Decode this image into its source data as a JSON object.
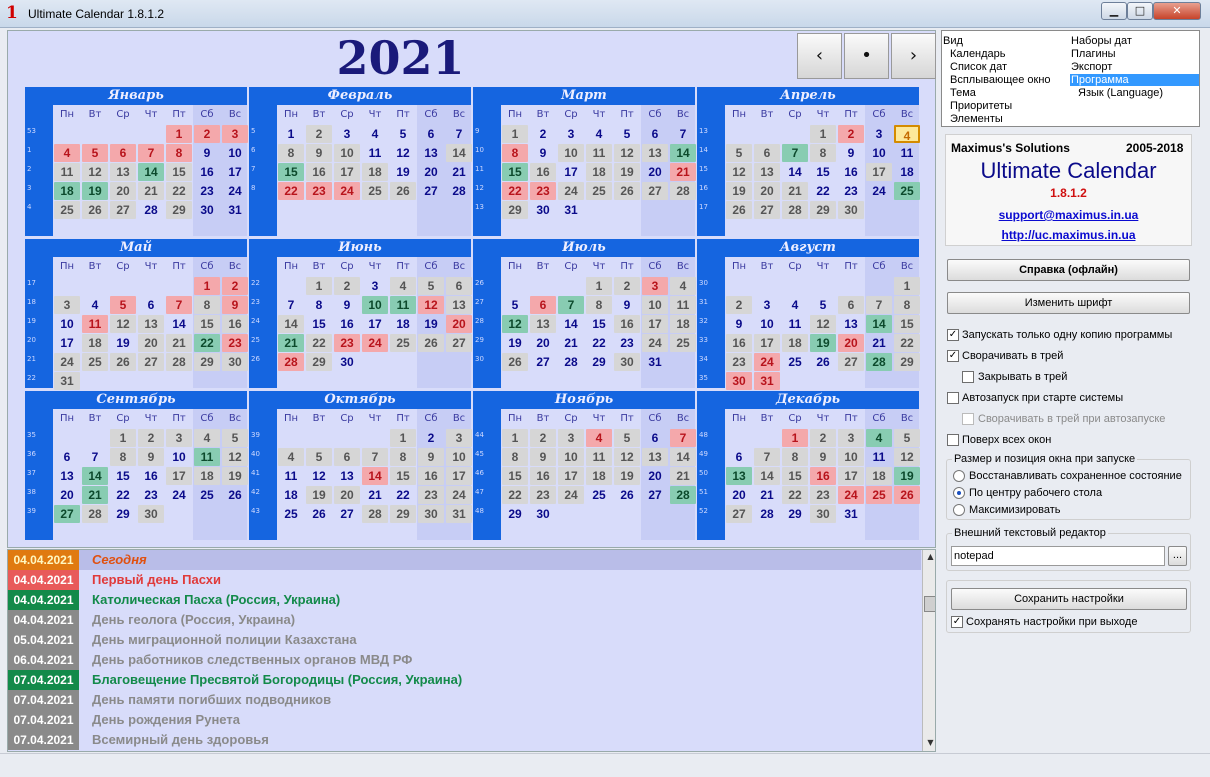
{
  "window": {
    "title": "Ultimate Calendar 1.8.1.2",
    "icon": "1",
    "min": "▁",
    "max": "□",
    "close": "✕"
  },
  "year": "2021",
  "nav": {
    "prev": "‹",
    "today": "•",
    "next": "›"
  },
  "daynames": [
    "Пн",
    "Вт",
    "Ср",
    "Чт",
    "Пт",
    "Сб",
    "Вс"
  ],
  "months": [
    {
      "name": "Январь",
      "weeks": [
        "53",
        "1",
        "2",
        "3",
        "4"
      ],
      "start": 4,
      "days": 31,
      "hol": [
        1,
        2,
        3,
        4,
        5,
        6,
        7,
        8
      ],
      "ev": [
        14,
        18,
        19
      ],
      "wk": [
        4,
        5,
        6,
        7,
        8,
        11,
        12,
        13,
        14,
        15,
        18,
        19,
        20,
        21,
        22,
        25,
        26,
        27,
        29
      ]
    },
    {
      "name": "Февраль",
      "weeks": [
        "5",
        "6",
        "7",
        "8"
      ],
      "start": 0,
      "days": 28,
      "hol": [
        22,
        23,
        24
      ],
      "ev": [
        15
      ],
      "wk": [
        2,
        8,
        9,
        10,
        14,
        16,
        17,
        18,
        25,
        26
      ]
    },
    {
      "name": "Март",
      "weeks": [
        "9",
        "10",
        "11",
        "12",
        "13"
      ],
      "start": 0,
      "days": 31,
      "hol": [
        8,
        21,
        22,
        23
      ],
      "ev": [
        14,
        15
      ],
      "wk": [
        1,
        10,
        11,
        12,
        13,
        16,
        18,
        19,
        24,
        25,
        26,
        27,
        28,
        29
      ]
    },
    {
      "name": "Апрель",
      "weeks": [
        "13",
        "14",
        "15",
        "16",
        "17"
      ],
      "start": 3,
      "days": 30,
      "hol": [
        2
      ],
      "ev": [
        7,
        25
      ],
      "wk": [
        1,
        5,
        6,
        8,
        12,
        13,
        17,
        19,
        20,
        21,
        26,
        27,
        28,
        29,
        30
      ],
      "today": 4
    },
    {
      "name": "Май",
      "weeks": [
        "17",
        "18",
        "19",
        "20",
        "21",
        "22"
      ],
      "start": 5,
      "days": 31,
      "hol": [
        1,
        2,
        5,
        7,
        9,
        11,
        23
      ],
      "ev": [
        22
      ],
      "wk": [
        3,
        8,
        12,
        13,
        15,
        16,
        18,
        20,
        21,
        24,
        25,
        26,
        27,
        28,
        29,
        30,
        31
      ]
    },
    {
      "name": "Июнь",
      "weeks": [
        "22",
        "23",
        "24",
        "25",
        "26"
      ],
      "start": 1,
      "days": 30,
      "hol": [
        12,
        20,
        23,
        24,
        28
      ],
      "ev": [
        10,
        11,
        21
      ],
      "wk": [
        1,
        2,
        4,
        5,
        6,
        13,
        14,
        22,
        25,
        26,
        27,
        29
      ]
    },
    {
      "name": "Июль",
      "weeks": [
        "26",
        "27",
        "28",
        "29",
        "30"
      ],
      "start": 3,
      "days": 31,
      "hol": [
        3,
        6
      ],
      "ev": [
        7,
        12
      ],
      "wk": [
        1,
        2,
        4,
        8,
        10,
        11,
        13,
        16,
        17,
        18,
        24,
        25,
        26,
        30
      ]
    },
    {
      "name": "Август",
      "weeks": [
        "30",
        "31",
        "32",
        "33",
        "34",
        "35"
      ],
      "start": 6,
      "days": 31,
      "hol": [
        20,
        24,
        30,
        31
      ],
      "ev": [
        14,
        19,
        28
      ],
      "wk": [
        1,
        2,
        6,
        7,
        8,
        12,
        15,
        16,
        17,
        18,
        22,
        23,
        27,
        29
      ]
    },
    {
      "name": "Сентябрь",
      "weeks": [
        "35",
        "36",
        "37",
        "38",
        "39"
      ],
      "start": 2,
      "days": 30,
      "hol": [],
      "ev": [
        11,
        14,
        21,
        27
      ],
      "wk": [
        1,
        2,
        3,
        4,
        5,
        8,
        9,
        12,
        17,
        18,
        19,
        28,
        30
      ]
    },
    {
      "name": "Октябрь",
      "weeks": [
        "39",
        "40",
        "41",
        "42",
        "43"
      ],
      "start": 4,
      "days": 31,
      "hol": [
        14
      ],
      "ev": [],
      "wk": [
        1,
        3,
        4,
        5,
        6,
        7,
        8,
        9,
        10,
        15,
        16,
        17,
        19,
        20,
        23,
        24,
        28,
        29,
        30,
        31
      ]
    },
    {
      "name": "Ноябрь",
      "weeks": [
        "44",
        "45",
        "46",
        "47",
        "48"
      ],
      "start": 0,
      "days": 30,
      "hol": [
        4,
        7
      ],
      "ev": [
        28
      ],
      "wk": [
        1,
        2,
        3,
        5,
        8,
        9,
        10,
        11,
        12,
        13,
        14,
        15,
        16,
        17,
        18,
        19,
        21,
        22,
        23,
        24
      ]
    },
    {
      "name": "Декабрь",
      "weeks": [
        "48",
        "49",
        "50",
        "51",
        "52"
      ],
      "start": 2,
      "days": 31,
      "hol": [
        1,
        16,
        24,
        25,
        26
      ],
      "ev": [
        4,
        13,
        19
      ],
      "wk": [
        2,
        3,
        5,
        7,
        8,
        9,
        10,
        12,
        14,
        15,
        17,
        18,
        22,
        23,
        27,
        30
      ]
    }
  ],
  "events": [
    {
      "date": "04.04.2021",
      "text": "Сегодня",
      "dateBg": "#e07a10",
      "dateColor": "#fff8c0",
      "color": "#e05010",
      "rowBg": "#b9bde8",
      "italic": true
    },
    {
      "date": "04.04.2021",
      "text": "Первый день Пасхи",
      "dateBg": "#e85a5a",
      "dateColor": "#fff",
      "color": "#e03a3a",
      "rowBg": "",
      "italic": false
    },
    {
      "date": "04.04.2021",
      "text": "Католическая Пасха (Россия, Украина)",
      "dateBg": "#138a4a",
      "dateColor": "#fff",
      "color": "#138a4a",
      "rowBg": "",
      "italic": false
    },
    {
      "date": "04.04.2021",
      "text": "День геолога (Россия, Украина)",
      "dateBg": "#8a8a8a",
      "dateColor": "#fff",
      "color": "#8a8a8a",
      "rowBg": "",
      "italic": false
    },
    {
      "date": "05.04.2021",
      "text": "День миграционной полиции Казахстана",
      "dateBg": "#8a8a8a",
      "dateColor": "#fff",
      "color": "#8a8a8a",
      "rowBg": "",
      "italic": false
    },
    {
      "date": "06.04.2021",
      "text": "День работников следственных органов МВД РФ",
      "dateBg": "#8a8a8a",
      "dateColor": "#fff",
      "color": "#8a8a8a",
      "rowBg": "",
      "italic": false
    },
    {
      "date": "07.04.2021",
      "text": "Благовещение Пресвятой Богородицы (Россия, Украина)",
      "dateBg": "#138a4a",
      "dateColor": "#fff",
      "color": "#138a4a",
      "rowBg": "",
      "italic": false
    },
    {
      "date": "07.04.2021",
      "text": "День памяти погибших подводников",
      "dateBg": "#8a8a8a",
      "dateColor": "#fff",
      "color": "#8a8a8a",
      "rowBg": "",
      "italic": false
    },
    {
      "date": "07.04.2021",
      "text": "День рождения Рунета",
      "dateBg": "#8a8a8a",
      "dateColor": "#fff",
      "color": "#8a8a8a",
      "rowBg": "",
      "italic": false
    },
    {
      "date": "07.04.2021",
      "text": "Всемирный день здоровья",
      "dateBg": "#8a8a8a",
      "dateColor": "#fff",
      "color": "#8a8a8a",
      "rowBg": "",
      "italic": false
    }
  ],
  "menu": {
    "left": [
      "Вид",
      "Календарь",
      "Список дат",
      "Всплывающее окно",
      "Тема",
      "Приоритеты",
      "Элементы"
    ],
    "right": [
      "Наборы дат",
      "Плагины",
      "Экспорт",
      "Программа",
      "Язык (Language)"
    ],
    "selected": "Программа"
  },
  "about": {
    "company": "Maximus's Solutions",
    "years": "2005-2018",
    "product": "Ultimate Calendar",
    "version": "1.8.1.2",
    "email": "support@maximus.in.ua",
    "url": "http://uc.maximus.in.ua"
  },
  "buttons": {
    "help": "Справка (офлайн)",
    "font": "Изменить шрифт",
    "save": "Сохранить настройки",
    "browse": "..."
  },
  "options": {
    "single": "Запускать только одну копию программы",
    "tray": "Сворачивать в трей",
    "closetray": "Закрывать в трей",
    "autostart": "Автозапуск при старте системы",
    "autotray": "Сворачивать в трей при автозапуске",
    "ontop": "Поверх всех окон",
    "sizegroup": "Размер и позиция окна при запуске",
    "restore": "Восстанавливать сохраненное состояние",
    "center": "По центру рабочего стола",
    "maximize": "Максимизировать",
    "editorgroup": "Внешний текстовый редактор",
    "editor": "notepad",
    "saveonexit": "Сохранять настройки при выходе",
    "check": "✓"
  }
}
